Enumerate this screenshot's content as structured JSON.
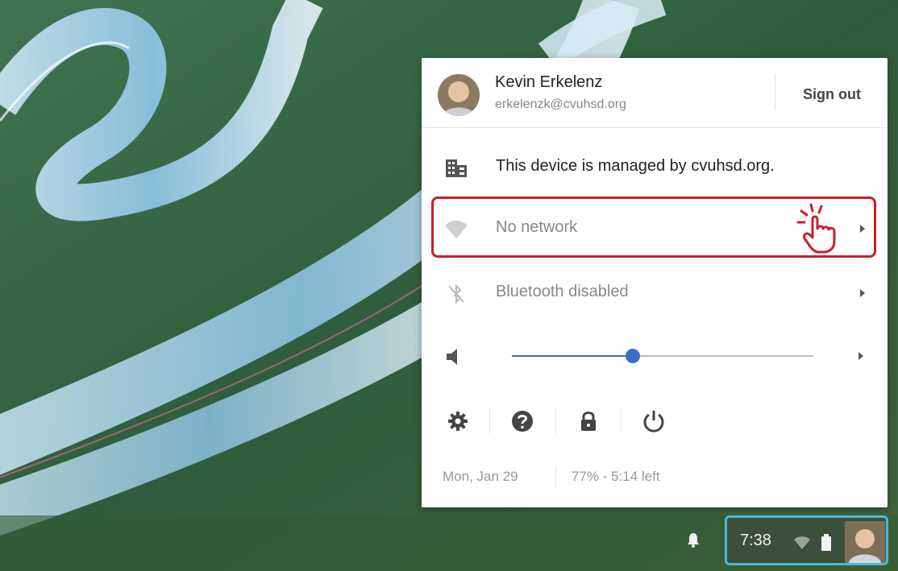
{
  "user": {
    "name": "Kevin Erkelenz",
    "email": "erkelenzk@cvuhsd.org",
    "sign_out_label": "Sign out"
  },
  "managed": {
    "text": "This device is managed by cvuhsd.org."
  },
  "network": {
    "label": "No network",
    "icon": "wifi-icon"
  },
  "bluetooth": {
    "label": "Bluetooth disabled",
    "icon": "bluetooth-off-icon"
  },
  "volume": {
    "level": 0.4,
    "icon": "speaker-icon"
  },
  "actions": [
    {
      "name": "settings",
      "icon": "gear-icon"
    },
    {
      "name": "help",
      "icon": "help-icon"
    },
    {
      "name": "lock",
      "icon": "lock-icon"
    },
    {
      "name": "power",
      "icon": "power-icon"
    }
  ],
  "status": {
    "date": "Mon, Jan 29",
    "battery": "77% - 5:14 left"
  },
  "shelf": {
    "clock": "7:38"
  },
  "colors": {
    "accent": "#3a6fc6",
    "highlight": "#c8202a",
    "tray_outline": "#4fb6d8"
  }
}
